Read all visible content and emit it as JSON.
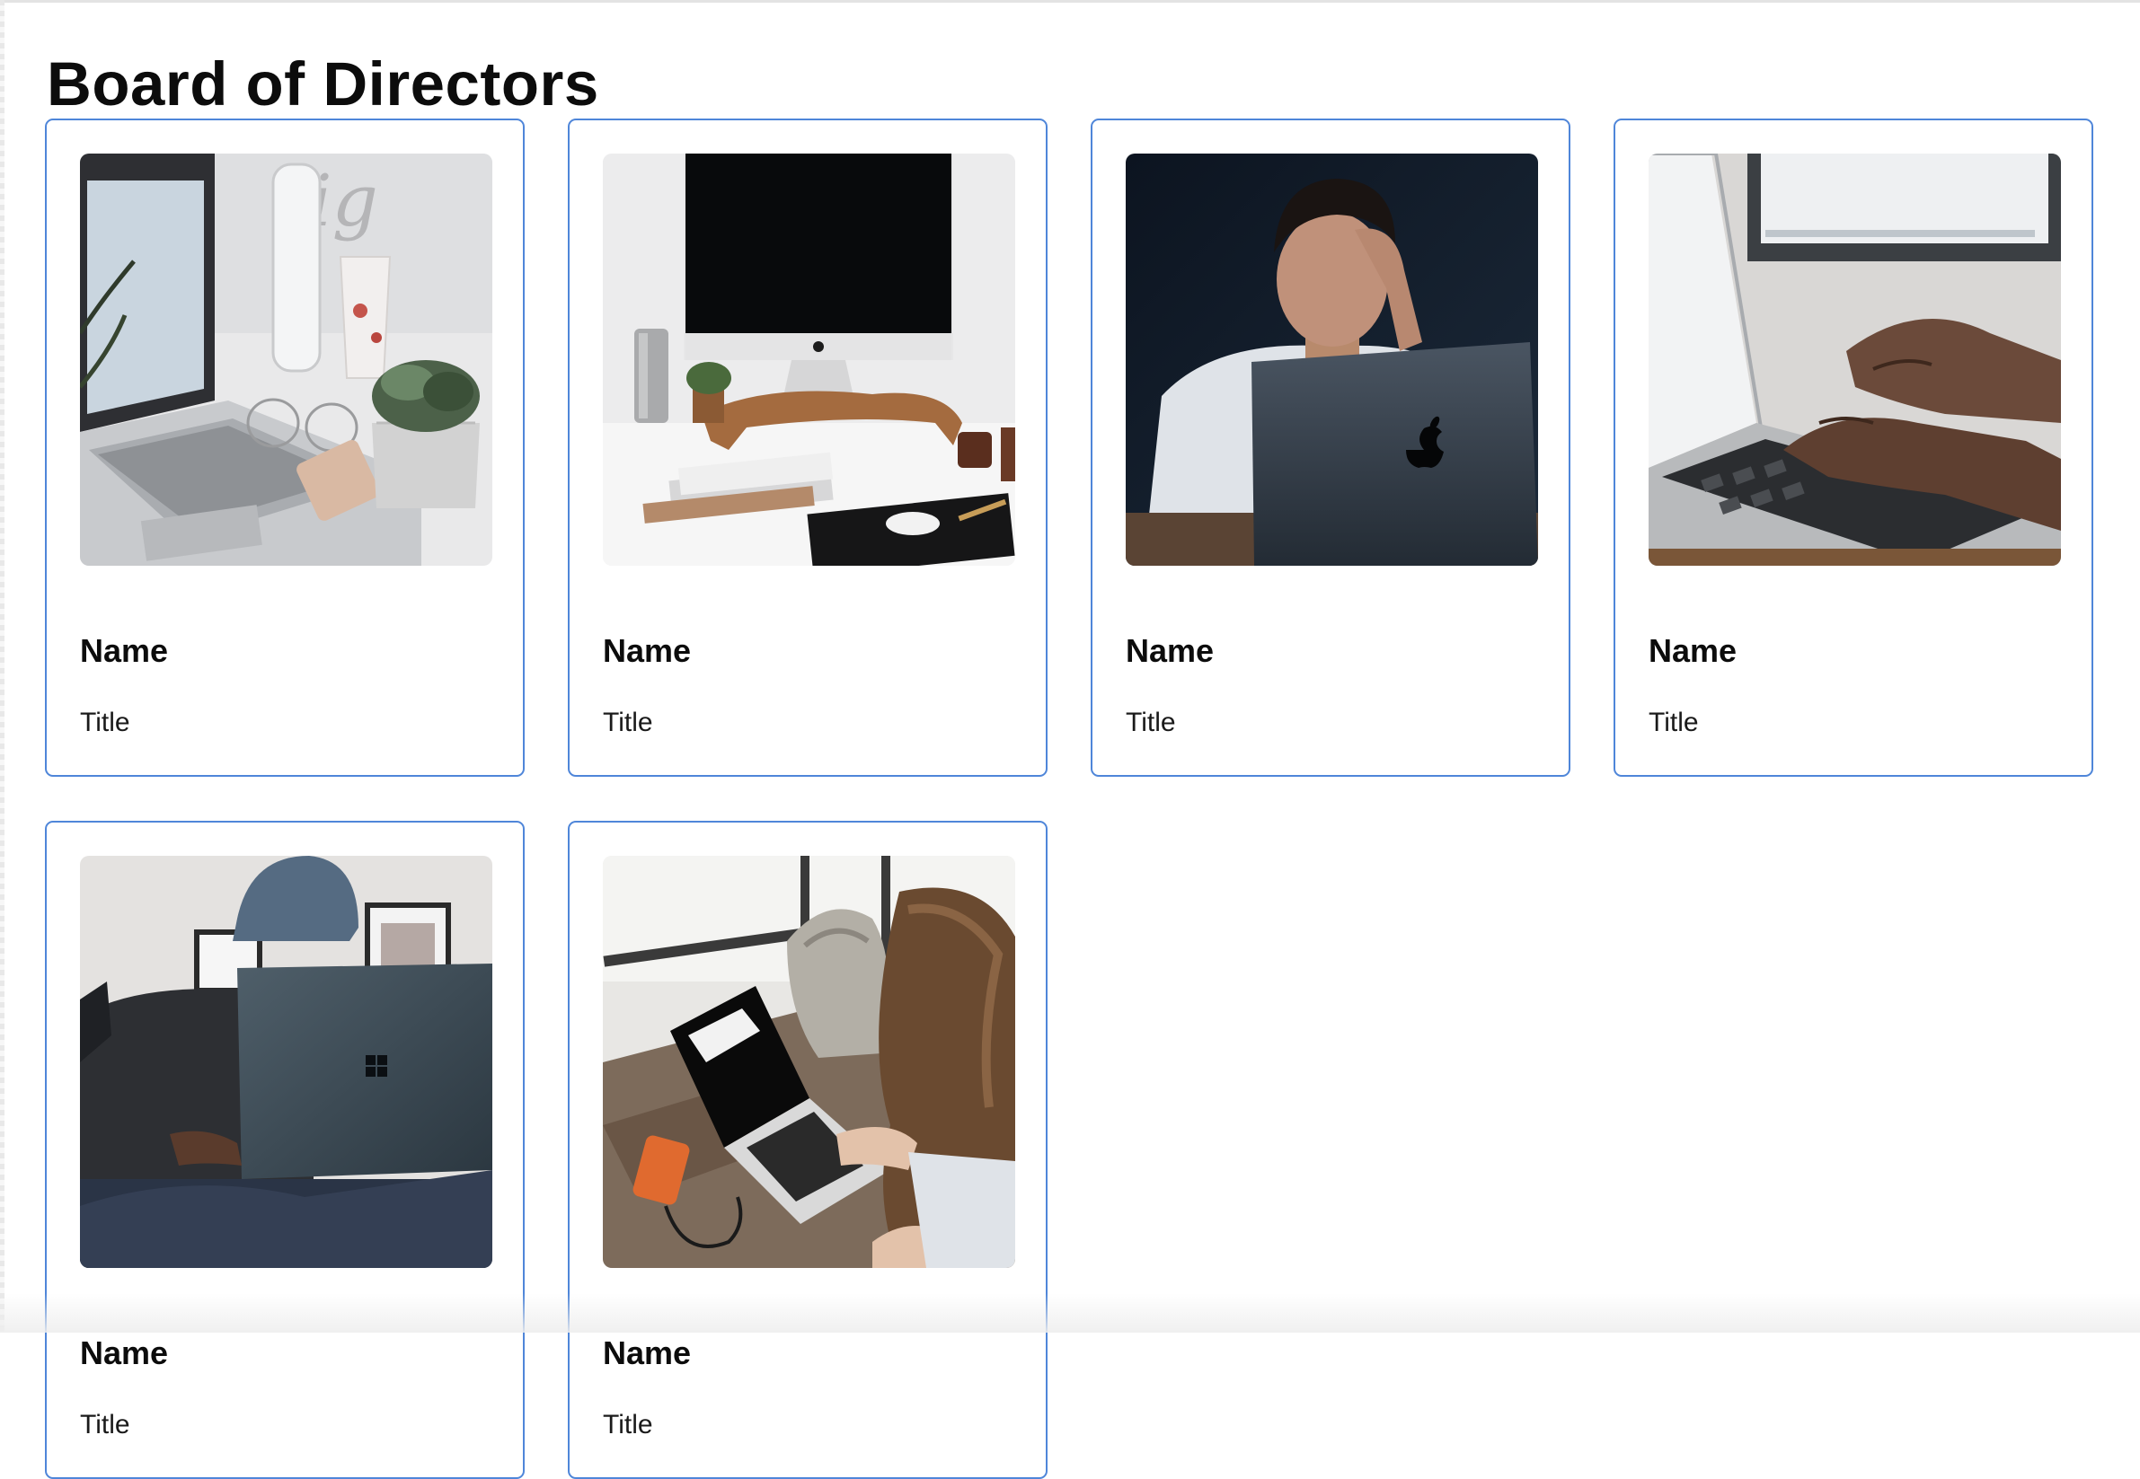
{
  "heading": "Board of Directors",
  "members": [
    {
      "name": "Name",
      "title": "Title",
      "photo": "laptop-desk-plant-photo"
    },
    {
      "name": "Name",
      "title": "Title",
      "photo": "imac-desk-setup-photo"
    },
    {
      "name": "Name",
      "title": "Title",
      "photo": "man-behind-macbook-photo"
    },
    {
      "name": "Name",
      "title": "Title",
      "photo": "hands-typing-laptop-photo"
    },
    {
      "name": "Name",
      "title": "Title",
      "photo": "man-in-beanie-laptop-photo"
    },
    {
      "name": "Name",
      "title": "Title",
      "photo": "woman-laptop-window-photo"
    }
  ],
  "colors": {
    "card_border": "#4f86d9",
    "text": "#0c0c0c",
    "background": "#ffffff"
  }
}
